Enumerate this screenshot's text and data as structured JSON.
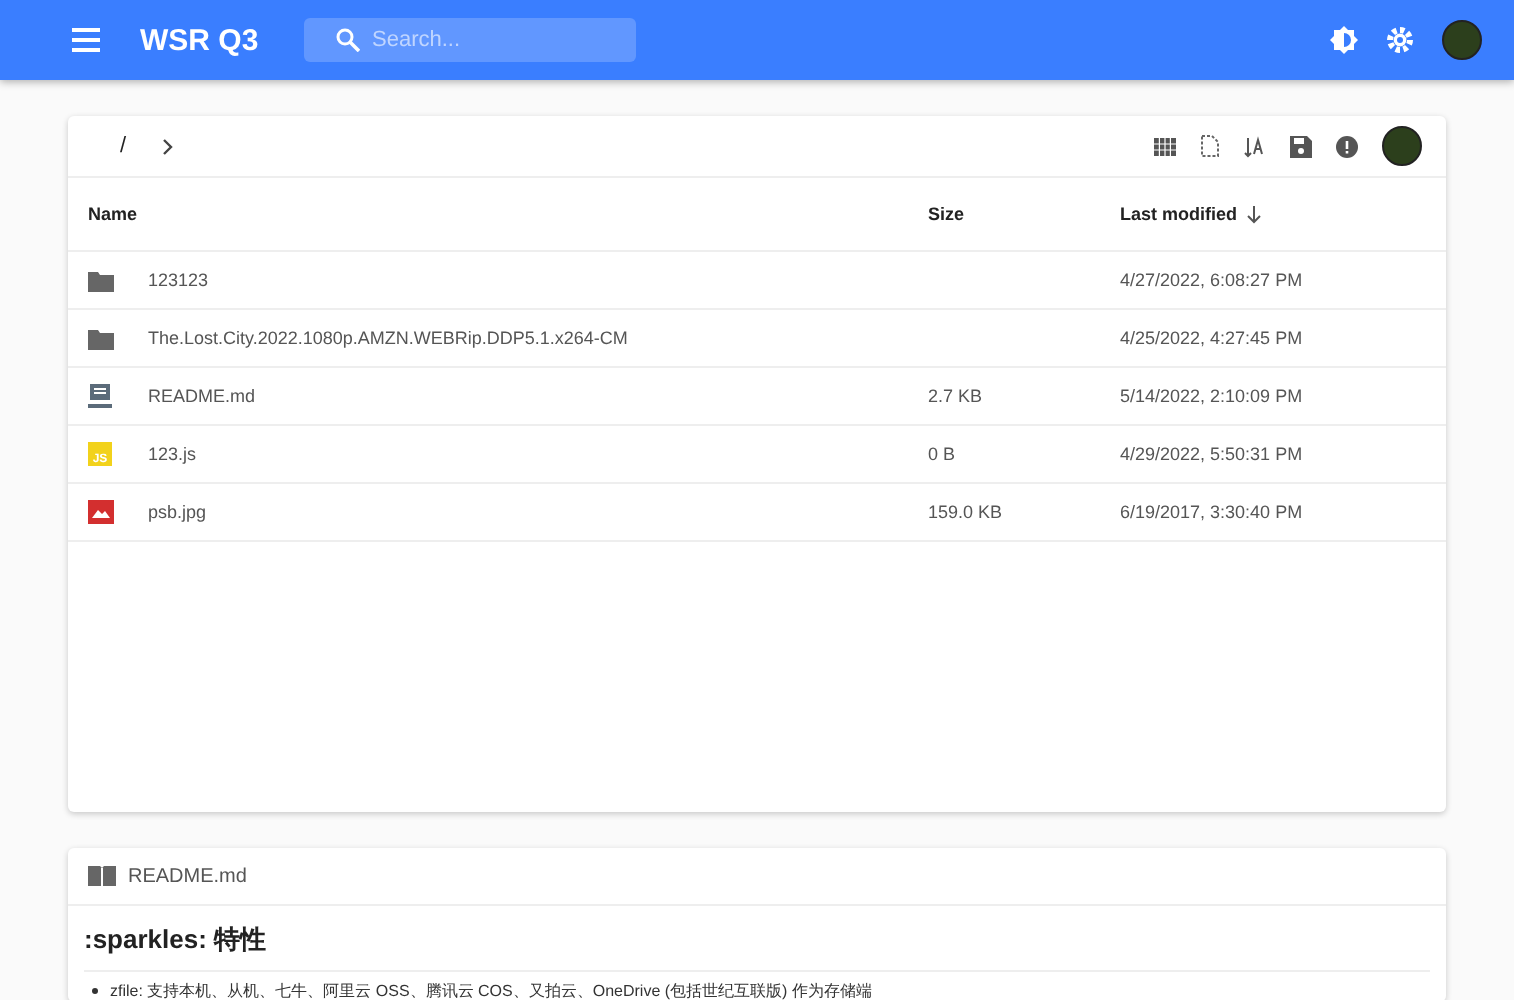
{
  "header": {
    "title": "WSR Q3",
    "search": {
      "placeholder": "Search..."
    }
  },
  "toolbar": {
    "breadcrumb": [
      "/"
    ]
  },
  "table": {
    "columns": [
      {
        "label": "Name",
        "sorted": false
      },
      {
        "label": "Size",
        "sorted": false
      },
      {
        "label": "Last modified",
        "sorted": true
      }
    ],
    "rows": [
      {
        "kind": "folder",
        "name": "123123",
        "size": "",
        "modified": "4/27/2022, 6:08:27 PM"
      },
      {
        "kind": "folder",
        "name": "The.Lost.City.2022.1080p.AMZN.WEBRip.DDP5.1.x264-CM",
        "size": "",
        "modified": "4/25/2022, 4:27:45 PM"
      },
      {
        "kind": "markdown",
        "name": "README.md",
        "size": "2.7 KB",
        "modified": "5/14/2022, 2:10:09 PM"
      },
      {
        "kind": "script",
        "badge": "JS",
        "name": "123.js",
        "size": "0 B",
        "modified": "4/29/2022, 5:50:31 PM"
      },
      {
        "kind": "image",
        "name": "psb.jpg",
        "size": "159.0 KB",
        "modified": "6/19/2017, 3:30:40 PM"
      }
    ]
  },
  "readme": {
    "title": "README.md",
    "heading": ":sparkles: 特性",
    "items": [
      "zfile: 支持本机、从机、七牛、阿里云 OSS、腾讯云 COS、又拍云、OneDrive (包括世纪互联版) 作为存储端"
    ]
  }
}
